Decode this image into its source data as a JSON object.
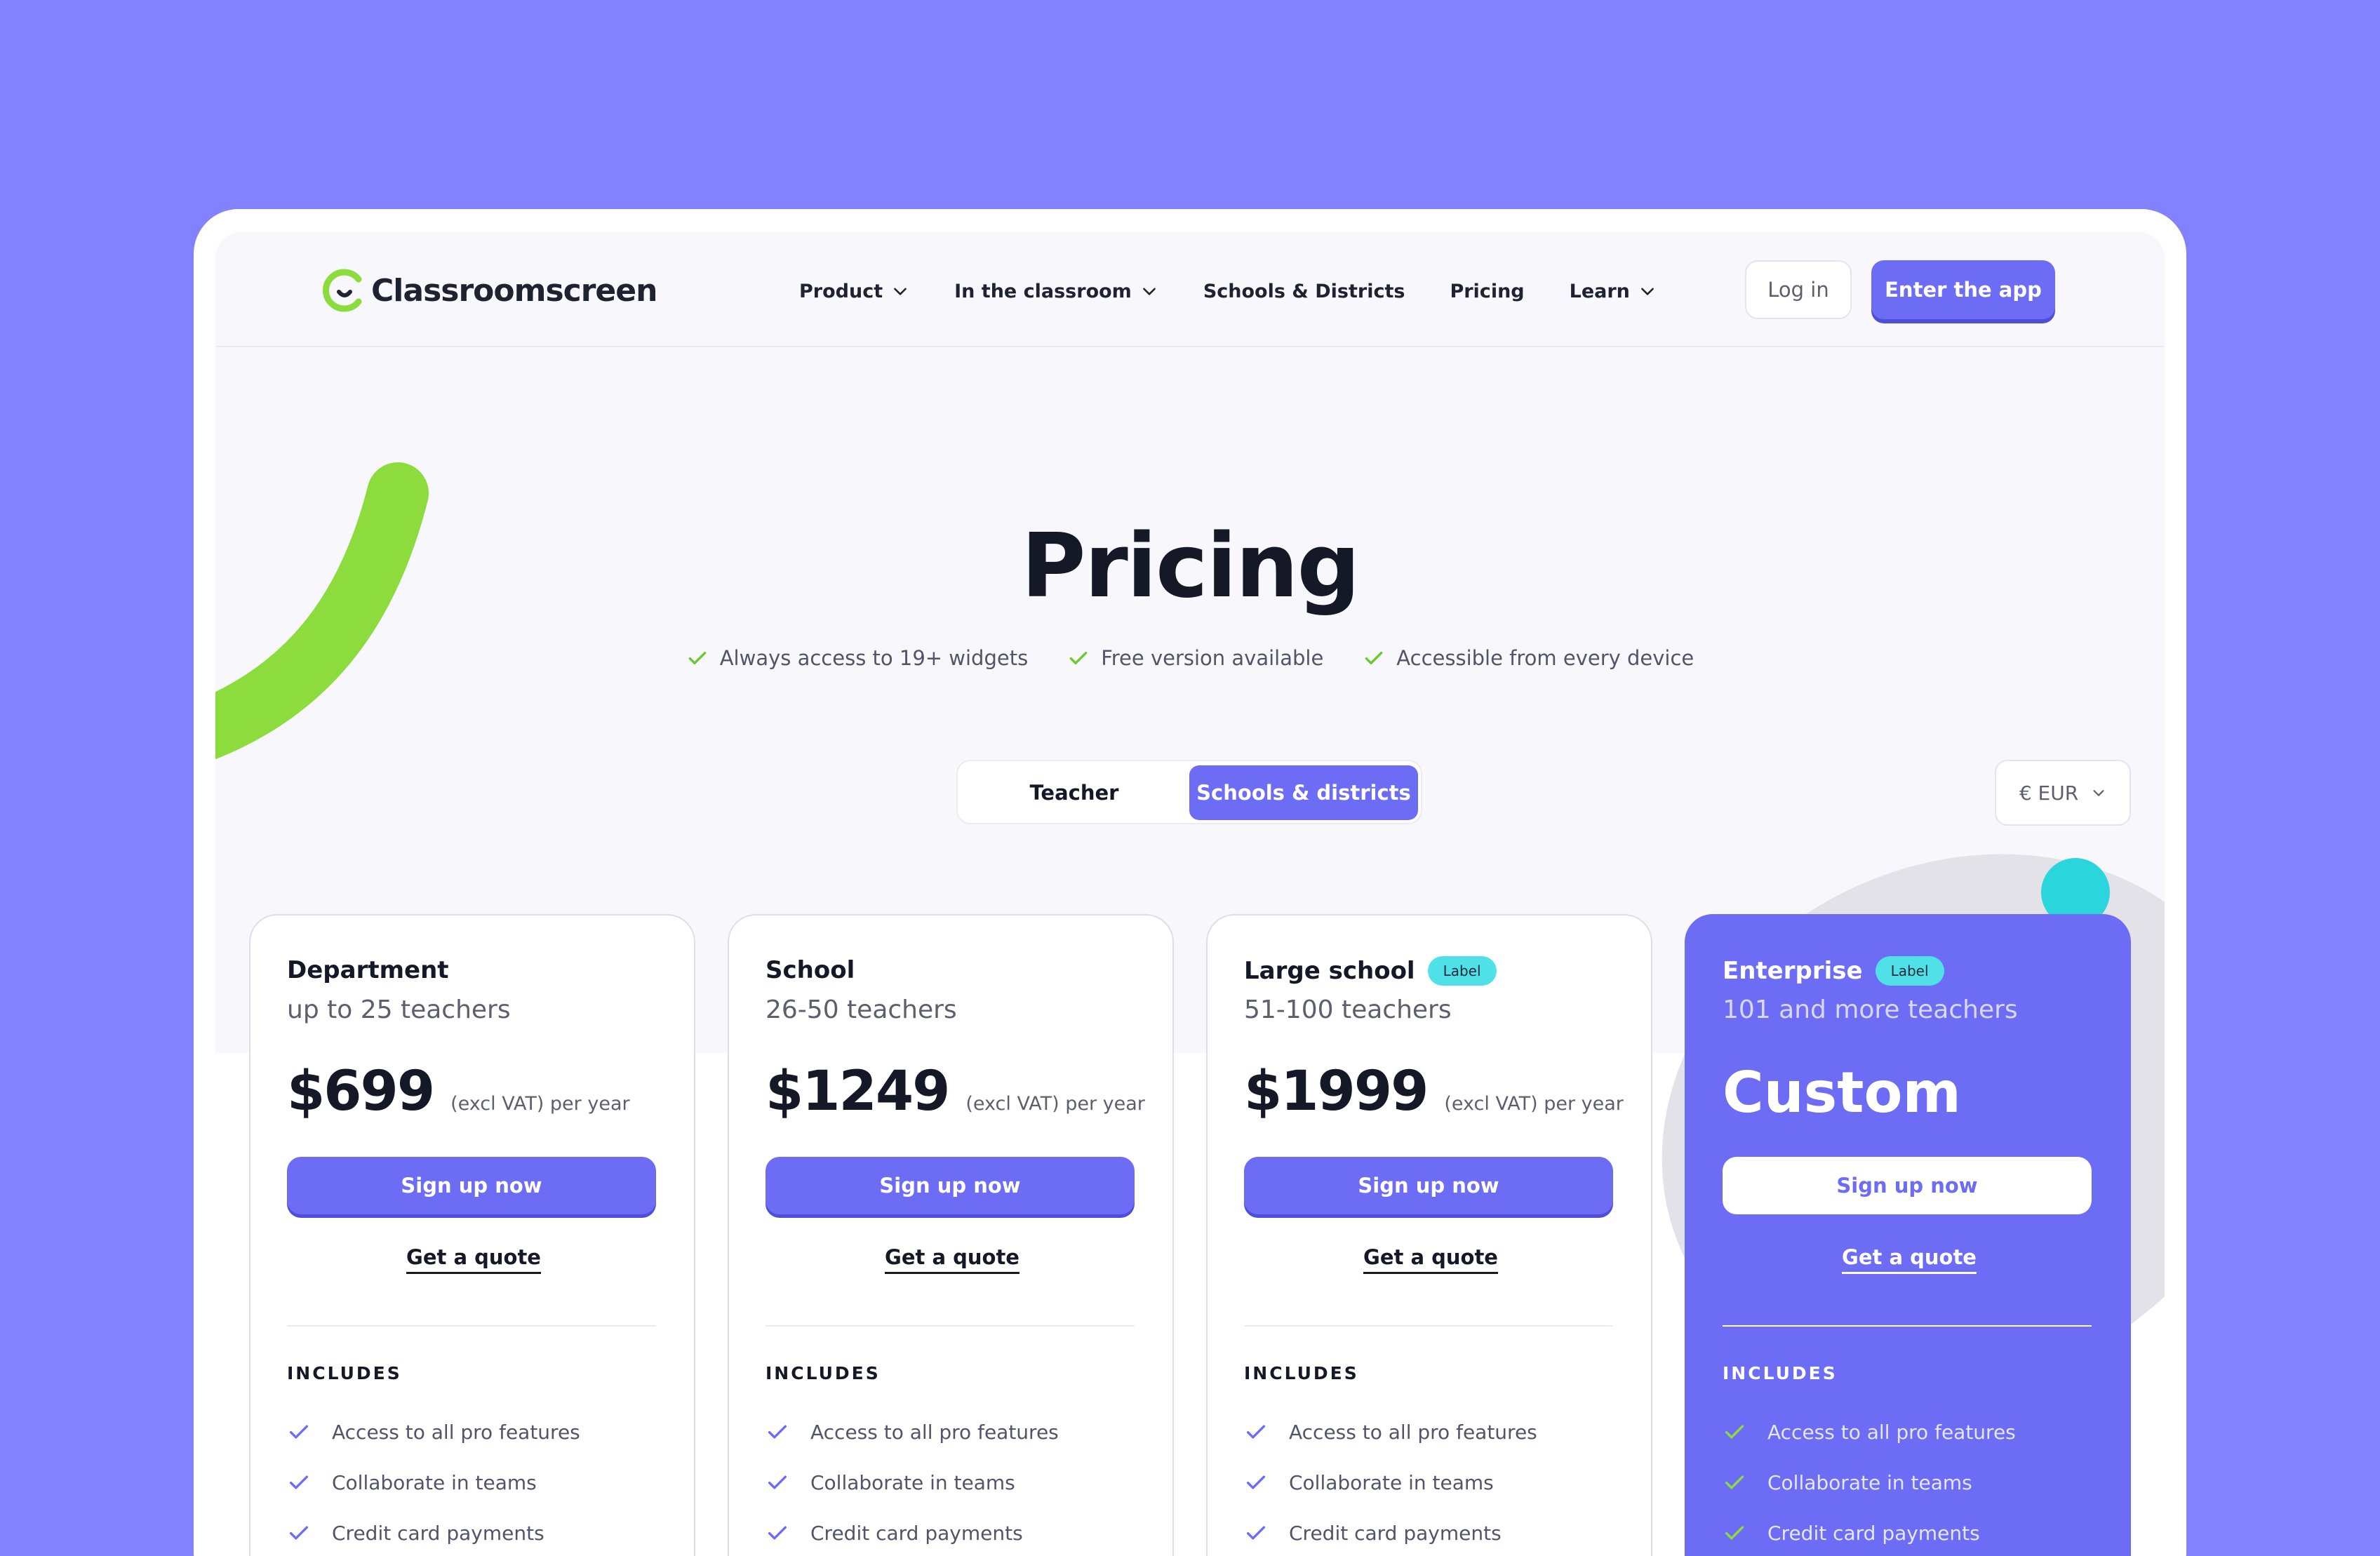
{
  "brand": {
    "name": "Classroomscreen",
    "logo_color": "#8ddc3e"
  },
  "nav": {
    "items": [
      {
        "label": "Product",
        "dropdown": true
      },
      {
        "label": "In the classroom",
        "dropdown": true
      },
      {
        "label": "Schools & Districts",
        "dropdown": false
      },
      {
        "label": "Pricing",
        "dropdown": false
      },
      {
        "label": "Learn",
        "dropdown": true
      }
    ],
    "login": "Log in",
    "enter": "Enter the app"
  },
  "hero": {
    "title": "Pricing",
    "features": [
      "Always access to 19+ widgets",
      "Free version available",
      "Accessible from every device"
    ]
  },
  "toggle": {
    "options": [
      "Teacher",
      "Schools & districts"
    ],
    "selected": "Schools & districts"
  },
  "currency": {
    "value": "€ EUR"
  },
  "plans": [
    {
      "name": "Department",
      "badge": "",
      "subtitle": "up to 25 teachers",
      "price": "$699",
      "price_note": "(excl VAT) per year",
      "cta": "Sign up now",
      "quote": "Get a quote",
      "includes_title": "INCLUDES",
      "features": [
        "Access to all pro features",
        "Collaborate in teams",
        "Credit card payments"
      ]
    },
    {
      "name": "School",
      "badge": "",
      "subtitle": "26-50 teachers",
      "price": "$1249",
      "price_note": "(excl VAT) per year",
      "cta": "Sign up now",
      "quote": "Get a quote",
      "includes_title": "INCLUDES",
      "features": [
        "Access to all pro features",
        "Collaborate in teams",
        "Credit card payments"
      ]
    },
    {
      "name": "Large school",
      "badge": "Label",
      "subtitle": "51-100 teachers",
      "price": "$1999",
      "price_note": "(excl VAT) per year",
      "cta": "Sign up now",
      "quote": "Get a quote",
      "includes_title": "INCLUDES",
      "features": [
        "Access to all pro features",
        "Collaborate in teams",
        "Credit card payments"
      ]
    },
    {
      "name": "Enterprise",
      "badge": "Label",
      "subtitle": "101 and more teachers",
      "price": "Custom",
      "cta": "Sign up now",
      "quote": "Get a quote",
      "includes_title": "INCLUDES",
      "features": [
        "Access to all pro features",
        "Collaborate in teams",
        "Credit card payments"
      ]
    }
  ],
  "colors": {
    "background": "#8282fe",
    "accent": "#6c6cf5",
    "check_green": "#6cc92f",
    "check_purple": "#6c6cf5",
    "badge": "#4fe0e8",
    "deco_green": "#8ddc3e",
    "deco_cyan": "#2ad6dc"
  },
  "icons": {
    "dropdown": "chevron-down-icon",
    "feature": "check-icon",
    "logo": "classroomscreen-logo-icon"
  }
}
